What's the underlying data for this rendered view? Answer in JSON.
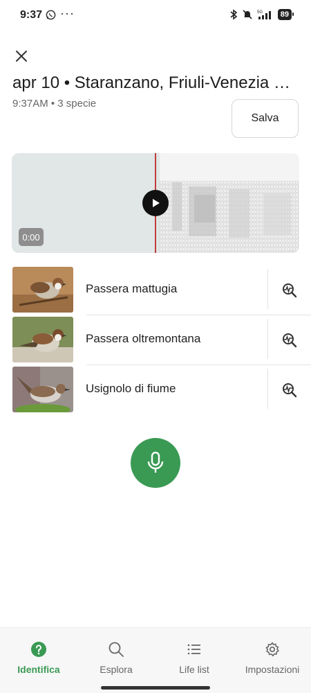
{
  "status_bar": {
    "time": "9:37",
    "network": "5G",
    "battery": "89"
  },
  "header": {
    "title": "apr 10 • Staranzano, Friuli-Venezia Gi...",
    "subtitle": "9:37AM • 3 specie",
    "save_label": "Salva"
  },
  "player": {
    "time": "0:00",
    "playhead_color": "#c23b3b"
  },
  "species": [
    {
      "name": "Passera mattugia"
    },
    {
      "name": "Passera oltremontana"
    },
    {
      "name": "Usignolo di fiume"
    }
  ],
  "nav": {
    "items": [
      {
        "label": "Identifica",
        "icon": "help-circle-icon",
        "active": true
      },
      {
        "label": "Esplora",
        "icon": "search-icon",
        "active": false
      },
      {
        "label": "Life list",
        "icon": "list-icon",
        "active": false
      },
      {
        "label": "Impostazioni",
        "icon": "gear-icon",
        "active": false
      }
    ]
  },
  "colors": {
    "accent": "#3a9a54",
    "text": "#1f1f1f",
    "muted": "#666666"
  }
}
